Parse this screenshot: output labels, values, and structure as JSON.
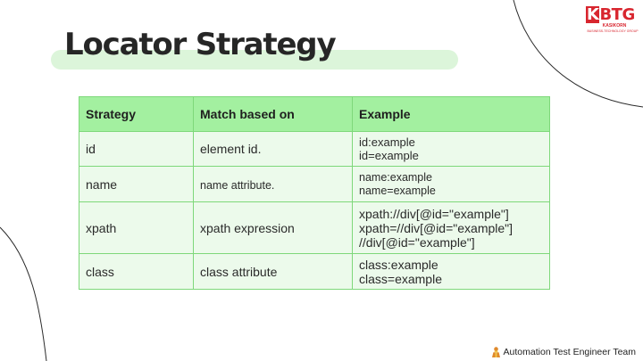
{
  "slide": {
    "title": "Locator Strategy"
  },
  "logo": {
    "k": "K",
    "rest": "BTG",
    "line1": "KASIKORN",
    "line2": "BUSINESS-TECHNOLOGY GROUP"
  },
  "table": {
    "headers": [
      "Strategy",
      "Match based on",
      "Example"
    ],
    "rows": [
      {
        "strategy": "id",
        "match": "element id.",
        "example": [
          "id:example",
          "id=example"
        ]
      },
      {
        "strategy": "name",
        "match": "name attribute.",
        "example": [
          "name:example",
          "name=example"
        ]
      },
      {
        "strategy": "xpath",
        "match": "xpath expression",
        "example": [
          "xpath://div[@id=\"example\"]",
          "xpath=//div[@id=\"example\"]",
          "//div[@id=\"example\"]"
        ]
      },
      {
        "strategy": "class",
        "match": "class attribute",
        "example": [
          "class:example",
          "class=example"
        ]
      }
    ]
  },
  "footer": {
    "team": "Automation Test Engineer Team",
    "icon": "person-icon"
  },
  "colors": {
    "header_bg": "#a3f0a0",
    "cell_bg": "#ecfaeb",
    "border": "#7ed87a",
    "title_highlight": "#dcf5da",
    "brand_red": "#d8262f"
  }
}
